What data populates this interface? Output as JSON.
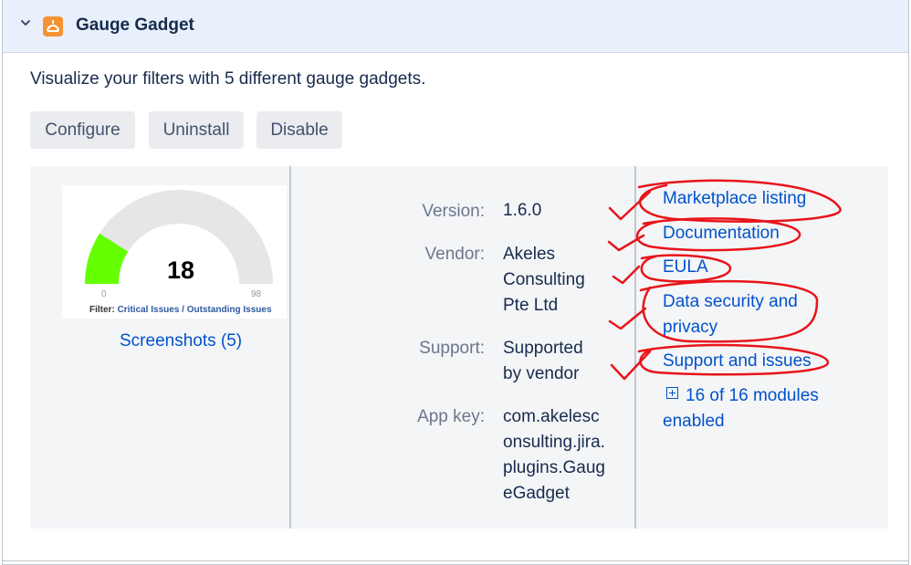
{
  "app": {
    "name": "Gauge Gadget",
    "description": "Visualize your filters with 5 different gauge gadgets.",
    "accent": "#f79232"
  },
  "actions": {
    "configure": "Configure",
    "uninstall": "Uninstall",
    "disable": "Disable"
  },
  "thumbnail": {
    "gauge_value": "18",
    "gauge_min": "0",
    "gauge_max": "98",
    "gauge_fill_fraction": 0.18,
    "filter_prefix": "Filter: ",
    "filter_name": "Critical Issues / Outstanding Issues",
    "fill_color": "#66ff00"
  },
  "screenshots_link": "Screenshots (5)",
  "meta": {
    "version_label": "Version:",
    "version_value": "1.6.0",
    "vendor_label": "Vendor:",
    "vendor_value": "Akeles Consulting Pte Ltd",
    "support_label": "Support:",
    "support_value": "Supported by vendor",
    "appkey_label": "App key:",
    "appkey_value": "com.akelesconsulting.jira.plugins.GaugeGadget"
  },
  "links": {
    "marketplace": "Marketplace listing",
    "documentation": "Documentation",
    "eula": "EULA",
    "data_security": "Data security and privacy",
    "support": "Support and issues",
    "modules": "16 of 16 modules enabled"
  },
  "annotation_color": "#e8141a"
}
